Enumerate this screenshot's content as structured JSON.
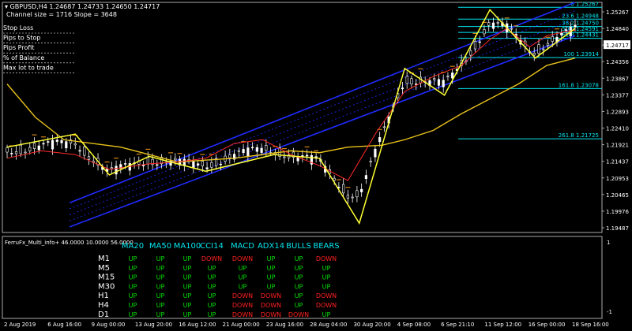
{
  "header": {
    "symbol": "GBPUSD,H4",
    "ohlc": "1.24687 1.24733 1.24650 1.24717",
    "channel_info": "Channel size = 1716 Slope = 3648"
  },
  "side_panel": {
    "items": [
      "Stop Loss",
      "Pips to Stop",
      "Pips Profit",
      "% of Balance",
      "Max lot to trade"
    ]
  },
  "colors": {
    "background": "#000000",
    "candle": "#ffffff",
    "ma_fast": "#ff2a2a",
    "ma_slow": "#e8c21a",
    "zigzag": "#ffff33",
    "channel": "#1f2cff",
    "fibo": "#00e5ee",
    "up": "#00e000",
    "down": "#ff2020"
  },
  "chart_data": {
    "type": "line",
    "price_axis": {
      "ylim": [
        1.192,
        1.254
      ],
      "ticks": [
        "1.25267",
        "1.24840",
        "1.24717",
        "1.24356",
        "1.23867",
        "1.23377",
        "1.22893",
        "1.22410",
        "1.21921",
        "1.21437",
        "1.20953",
        "1.20465",
        "1.19976",
        "1.19487"
      ],
      "current_price": "1.24717"
    },
    "time_axis": {
      "labels": [
        "2 Aug 2019",
        "6 Aug 16:00",
        "9 Aug 00:00",
        "13 Aug 20:00",
        "16 Aug 12:00",
        "21 Aug 00:00",
        "23 Aug 16:00",
        "28 Aug 04:00",
        "30 Aug 20:00",
        "4 Sep 08:00",
        "6 Sep 21:10",
        "11 Sep 12:00",
        "16 Sep 00:00",
        "18 Sep 16:00"
      ]
    },
    "zigzag": {
      "x": [
        0,
        12,
        18,
        25,
        35,
        47,
        55,
        62,
        70,
        77,
        85,
        93,
        100
      ],
      "y": [
        1.215,
        1.2185,
        1.2075,
        1.2125,
        1.2085,
        1.213,
        1.212,
        1.1945,
        1.2362,
        1.229,
        1.252,
        1.239,
        1.247
      ]
    },
    "ma_fast": {
      "x": [
        0,
        6,
        12,
        18,
        25,
        30,
        35,
        40,
        45,
        50,
        55,
        60,
        65,
        70,
        75,
        80,
        85,
        88,
        92,
        95,
        98,
        100
      ],
      "y": [
        1.212,
        1.214,
        1.213,
        1.209,
        1.2105,
        1.211,
        1.212,
        1.216,
        1.217,
        1.213,
        1.21,
        1.206,
        1.219,
        1.23,
        1.234,
        1.237,
        1.244,
        1.247,
        1.242,
        1.245,
        1.246,
        1.2465
      ]
    },
    "ma_slow": {
      "x": [
        0,
        5,
        10,
        20,
        30,
        40,
        50,
        55,
        60,
        66,
        70,
        75,
        80,
        85,
        90,
        95,
        100
      ],
      "y": [
        1.232,
        1.223,
        1.217,
        1.215,
        1.211,
        1.212,
        1.214,
        1.2135,
        1.215,
        1.2155,
        1.217,
        1.2195,
        1.224,
        1.228,
        1.232,
        1.237,
        1.239
      ]
    },
    "channel": {
      "upper": [
        [
          11,
          1.2
        ],
        [
          100,
          1.254
        ]
      ],
      "lower": [
        [
          11,
          1.1935
        ],
        [
          100,
          1.245
        ]
      ]
    },
    "fibonacci": [
      {
        "label": "0 1.25267",
        "value": 1.25267
      },
      {
        "label": "23.6 1.24948",
        "value": 1.24948
      },
      {
        "label": "38.2 1.24750",
        "value": 1.2475
      },
      {
        "label": "50.0 1.24591",
        "value": 1.24591
      },
      {
        "label": "61.8 1.24431",
        "value": 1.24431
      },
      {
        "label": "100 1.23914",
        "value": 1.23914
      },
      {
        "label": "161.8 1.23078",
        "value": 1.23078
      },
      {
        "label": "261.8 1.21725",
        "value": 1.21725
      }
    ]
  },
  "indicator_panel": {
    "title": "FerruFx_Multi_info+ 46.0000 10.0000 56.0000",
    "scale_top": "1",
    "scale_bottom": "-1",
    "columns": [
      "MA20",
      "MA50",
      "MA100",
      "CCI14",
      "MACD",
      "ADX14",
      "BULLS",
      "BEARS"
    ],
    "rows": [
      {
        "tf": "M1",
        "cells": [
          "UP",
          "UP",
          "UP",
          "DOWN",
          "DOWN",
          "UP",
          "UP",
          "DOWN"
        ]
      },
      {
        "tf": "M5",
        "cells": [
          "UP",
          "UP",
          "UP",
          "UP",
          "UP",
          "UP",
          "UP",
          "UP"
        ]
      },
      {
        "tf": "M15",
        "cells": [
          "UP",
          "UP",
          "UP",
          "UP",
          "UP",
          "UP",
          "UP",
          "UP"
        ]
      },
      {
        "tf": "M30",
        "cells": [
          "UP",
          "UP",
          "UP",
          "UP",
          "UP",
          "UP",
          "UP",
          "UP"
        ]
      },
      {
        "tf": "H1",
        "cells": [
          "UP",
          "UP",
          "UP",
          "UP",
          "DOWN",
          "DOWN",
          "UP",
          "DOWN"
        ]
      },
      {
        "tf": "H4",
        "cells": [
          "UP",
          "UP",
          "UP",
          "UP",
          "DOWN",
          "DOWN",
          "UP",
          "DOWN"
        ]
      },
      {
        "tf": "D1",
        "cells": [
          "UP",
          "UP",
          "UP",
          "UP",
          "DOWN",
          "DOWN",
          "DOWN",
          "UP"
        ]
      }
    ]
  }
}
